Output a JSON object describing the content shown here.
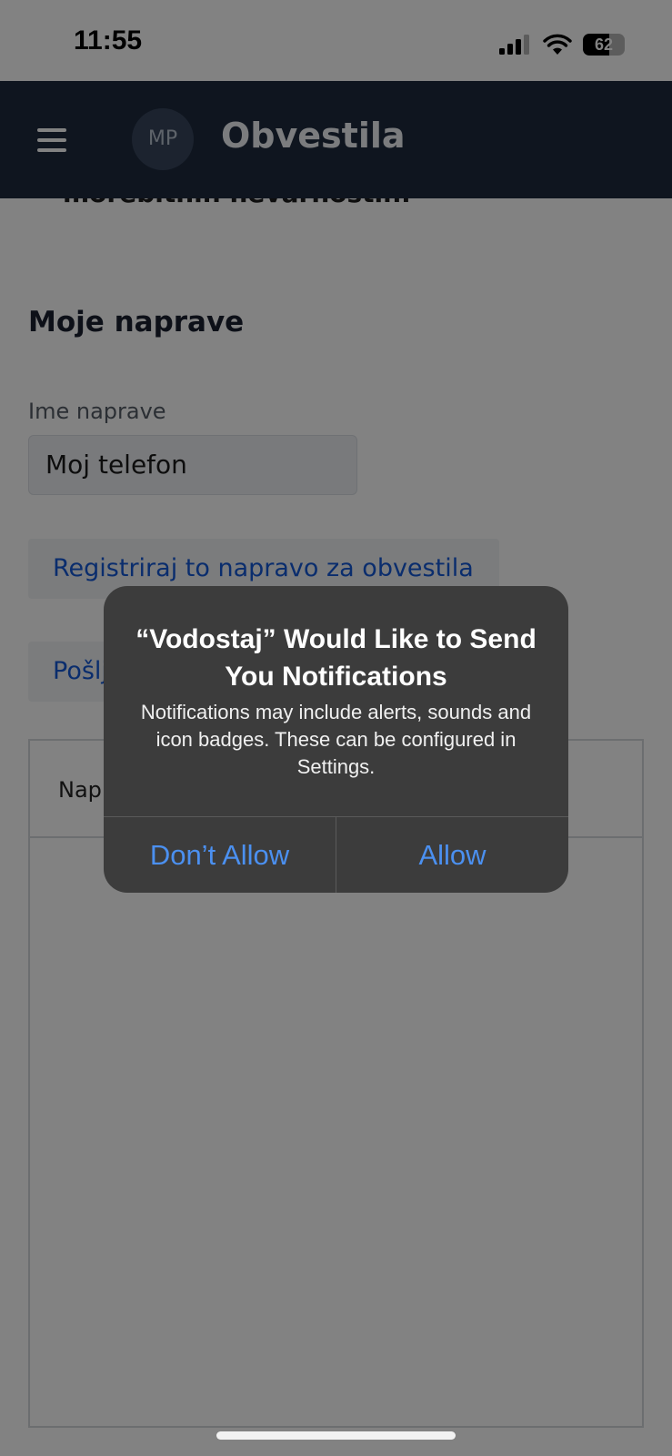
{
  "status_bar": {
    "time": "11:55",
    "battery_level": "62",
    "battery_fraction": 0.62,
    "icons": [
      "cellular-signal-icon",
      "wifi-icon",
      "battery-icon"
    ]
  },
  "header": {
    "avatar_initials": "MP",
    "title": "Obvestila",
    "menu_icon": "hamburger-menu-icon",
    "background_color": "#1e2a3e"
  },
  "content": {
    "cut_off_text": "morebitnih nevarnostih.",
    "section_title": "Moje naprave",
    "device_name_label": "Ime naprave",
    "device_name_value": "Moj telefon",
    "register_button": "Registriraj to napravo za obvestila",
    "send_button_partial": "Pošlj",
    "table_header_partial": "Nap"
  },
  "alert": {
    "title": "“Vodostaj” Would Like to Send You Notifications",
    "message": "Notifications may include alerts, sounds and icon badges. These can be configured in Settings.",
    "deny_button": "Don’t Allow",
    "allow_button": "Allow",
    "button_color": "#4b90f0"
  }
}
